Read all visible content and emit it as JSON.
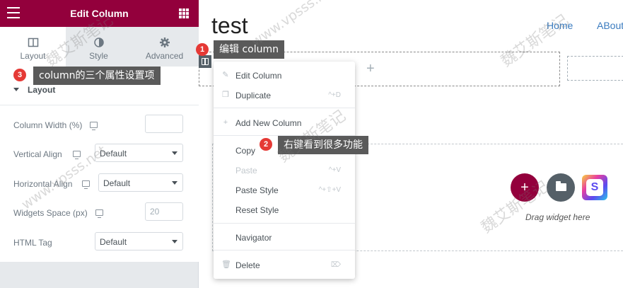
{
  "panel": {
    "title": "Edit Column",
    "tabs": [
      {
        "label": "Layout",
        "icon": "layout-icon",
        "active": true
      },
      {
        "label": "Style",
        "icon": "half-circle-icon",
        "active": false
      },
      {
        "label": "Advanced",
        "icon": "gear-icon",
        "active": false
      }
    ],
    "section_title": "Layout",
    "fields": {
      "column_width": {
        "label": "Column Width (%)",
        "value": ""
      },
      "vertical_align": {
        "label": "Vertical Align",
        "value": "Default"
      },
      "horizontal_align": {
        "label": "Horizontal Align",
        "value": "Default"
      },
      "widgets_space": {
        "label": "Widgets Space (px)",
        "placeholder": "20"
      },
      "html_tag": {
        "label": "HTML Tag",
        "value": "Default"
      }
    }
  },
  "canvas": {
    "site_title": "test",
    "nav": [
      "Home",
      "ABout"
    ],
    "add_section": "+",
    "add_button": "+",
    "drag_text": "Drag widget here",
    "s_logo": "S"
  },
  "context_menu": {
    "items": [
      {
        "label": "Edit Column",
        "icon": "pencil-icon",
        "shortcut": "",
        "disabled": false
      },
      {
        "label": "Duplicate",
        "icon": "duplicate-icon",
        "shortcut": "^+D",
        "disabled": false
      },
      {
        "label": "Add New Column",
        "icon": "plus-icon",
        "shortcut": "",
        "disabled": false
      },
      {
        "label": "Copy",
        "icon": "",
        "shortcut": "",
        "disabled": false
      },
      {
        "label": "Paste",
        "icon": "",
        "shortcut": "^+V",
        "disabled": true
      },
      {
        "label": "Paste Style",
        "icon": "",
        "shortcut": "^+⇧+V",
        "disabled": false
      },
      {
        "label": "Reset Style",
        "icon": "",
        "shortcut": "",
        "disabled": false
      },
      {
        "label": "Navigator",
        "icon": "",
        "shortcut": "",
        "disabled": false
      },
      {
        "label": "Delete",
        "icon": "trash-icon",
        "shortcut": "⌦",
        "disabled": false
      }
    ]
  },
  "annotations": [
    {
      "number": "1",
      "text": "编辑 column"
    },
    {
      "number": "2",
      "text": "右键看到很多功能"
    },
    {
      "number": "3",
      "text": "column的三个属性设置项"
    }
  ],
  "watermark": {
    "text": "魏艾斯笔记",
    "url": "www.vpsss.net"
  },
  "colors": {
    "brand": "#93003c",
    "annotation_bg": "#5a5a5a",
    "badge": "#e53935",
    "link": "#3a7bbf"
  }
}
